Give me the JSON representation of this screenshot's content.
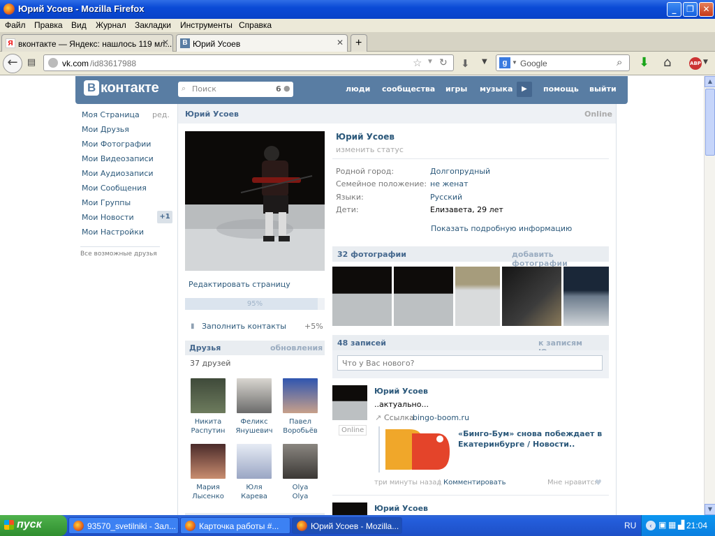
{
  "window": {
    "title": "Юрий Усоев - Mozilla Firefox"
  },
  "menu": [
    "Файл",
    "Правка",
    "Вид",
    "Журнал",
    "Закладки",
    "Инструменты",
    "Справка"
  ],
  "tabs": [
    {
      "label": "вконтакте — Яндекс: нашлось 119 мл...",
      "favicon": "Я"
    },
    {
      "label": "Юрий Усоев",
      "favicon": "B"
    }
  ],
  "nav": {
    "url_domain": "vk.com",
    "url_path": "/id83617988",
    "search_placeholder": "Google"
  },
  "vk": {
    "logo": "контакте",
    "logo_letter": "B",
    "search_placeholder": "Поиск",
    "search_count": "6",
    "nav": [
      "люди",
      "сообщества",
      "игры",
      "музыка",
      "помощь",
      "выйти"
    ]
  },
  "left_menu": {
    "items": [
      "Моя Страница",
      "Мои Друзья",
      "Мои Фотографии",
      "Мои Видеозаписи",
      "Мои Аудиозаписи",
      "Мои Сообщения",
      "Мои Группы",
      "Мои Новости",
      "Мои Настройки"
    ],
    "edit": "ред.",
    "news_badge": "+1",
    "possible_friends": "Все возможные друзья"
  },
  "profile": {
    "header_name": "Юрий Усоев",
    "online": "Online",
    "name": "Юрий Усоев",
    "status_hint": "изменить статус",
    "edit_page": "Редактировать страницу",
    "progress_label": "95%",
    "progress": 0.95,
    "fill_contacts": "Заполнить контакты",
    "fill_bonus": "+5%",
    "info": [
      {
        "label": "Родной город:",
        "value": "Долгопрудный",
        "link": true
      },
      {
        "label": "Семейное положение:",
        "value": "не женат",
        "link": true
      },
      {
        "label": "Языки:",
        "value": "Русский",
        "link": true
      },
      {
        "label": "Дети:",
        "value": "Елизавета, 29 лет",
        "link": false
      }
    ],
    "more_info": "Показать подробную информацию"
  },
  "friends": {
    "title": "Друзья",
    "updates": "обновления",
    "count": "37 друзей",
    "list": [
      {
        "first": "Никита",
        "last": "Распутин"
      },
      {
        "first": "Феликс",
        "last": "Янушевич"
      },
      {
        "first": "Павел",
        "last": "Воробьёв"
      },
      {
        "first": "Мария",
        "last": "Лысенко"
      },
      {
        "first": "Юля",
        "last": "Карева"
      },
      {
        "first": "Olya",
        "last": "Olya"
      }
    ]
  },
  "photos": {
    "title": "32 фотографии",
    "add": "добавить фотографии"
  },
  "wall": {
    "title": "48 записей",
    "to_posts": "к записям Юрия",
    "placeholder": "Что у Вас нового?",
    "posts": [
      {
        "author": "Юрий Усоев",
        "text": "..актуально...",
        "online": "Online",
        "link_prefix": "Ссылка",
        "link_domain": "bingo-boom.ru",
        "link_title": "«Бинго-Бум» снова побеждает в Екатеринбурге / Новости..",
        "time": "три минуты назад",
        "comment": "Комментировать",
        "like": "Мне нравится"
      },
      {
        "author": "Юрий Усоев"
      }
    ]
  },
  "taskbar": {
    "start": "пуск",
    "tasks": [
      "93570_svetilniki - Зал...",
      "Карточка работы #...",
      "Юрий Усоев - Mozilla..."
    ],
    "lang": "RU",
    "clock": "21:04"
  }
}
